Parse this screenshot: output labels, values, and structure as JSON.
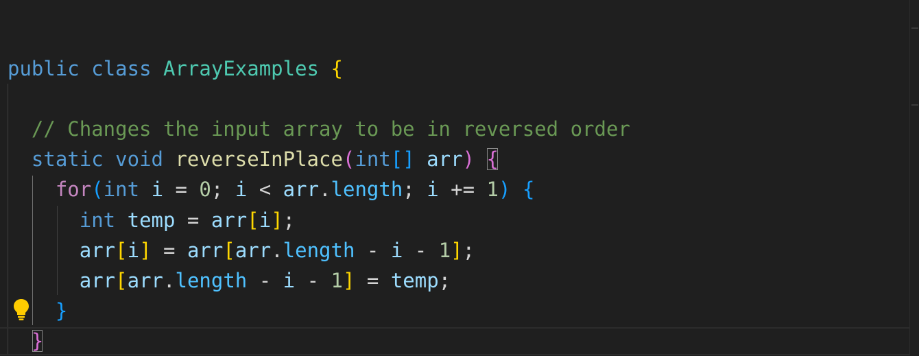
{
  "code_lines": [
    {
      "tokens": [
        {
          "t": "public",
          "c": "kw"
        },
        {
          "t": " ",
          "c": "op"
        },
        {
          "t": "class",
          "c": "kw"
        },
        {
          "t": " ",
          "c": "op"
        },
        {
          "t": "ArrayExamples",
          "c": "type"
        },
        {
          "t": " ",
          "c": "op"
        },
        {
          "t": "{",
          "c": "b1"
        }
      ]
    },
    {
      "tokens": [
        {
          "t": "  ",
          "c": "op"
        },
        {
          "t": "// Changes the input array to be in reversed order",
          "c": "cmt"
        }
      ]
    },
    {
      "tokens": [
        {
          "t": "  ",
          "c": "op"
        },
        {
          "t": "static",
          "c": "kw"
        },
        {
          "t": " ",
          "c": "op"
        },
        {
          "t": "void",
          "c": "kw"
        },
        {
          "t": " ",
          "c": "op"
        },
        {
          "t": "reverseInPlace",
          "c": "fn"
        },
        {
          "t": "(",
          "c": "b2"
        },
        {
          "t": "int",
          "c": "kw"
        },
        {
          "t": "[]",
          "c": "b3"
        },
        {
          "t": " ",
          "c": "op"
        },
        {
          "t": "arr",
          "c": "var"
        },
        {
          "t": ")",
          "c": "b2"
        },
        {
          "t": " ",
          "c": "op"
        },
        {
          "t": "{",
          "c": "b2",
          "match": true
        }
      ]
    },
    {
      "tokens": [
        {
          "t": "    ",
          "c": "op"
        },
        {
          "t": "for",
          "c": "ctl"
        },
        {
          "t": "(",
          "c": "b3"
        },
        {
          "t": "int",
          "c": "kw"
        },
        {
          "t": " ",
          "c": "op"
        },
        {
          "t": "i",
          "c": "var"
        },
        {
          "t": " = ",
          "c": "op"
        },
        {
          "t": "0",
          "c": "num"
        },
        {
          "t": "; ",
          "c": "op"
        },
        {
          "t": "i",
          "c": "var"
        },
        {
          "t": " < ",
          "c": "op"
        },
        {
          "t": "arr",
          "c": "var"
        },
        {
          "t": ".",
          "c": "op"
        },
        {
          "t": "length",
          "c": "prop"
        },
        {
          "t": "; ",
          "c": "op"
        },
        {
          "t": "i",
          "c": "var"
        },
        {
          "t": " += ",
          "c": "op"
        },
        {
          "t": "1",
          "c": "num"
        },
        {
          "t": ")",
          "c": "b3"
        },
        {
          "t": " ",
          "c": "op"
        },
        {
          "t": "{",
          "c": "b3"
        }
      ]
    },
    {
      "tokens": [
        {
          "t": "      ",
          "c": "op"
        },
        {
          "t": "int",
          "c": "kw"
        },
        {
          "t": " ",
          "c": "op"
        },
        {
          "t": "temp",
          "c": "var"
        },
        {
          "t": " = ",
          "c": "op"
        },
        {
          "t": "arr",
          "c": "var"
        },
        {
          "t": "[",
          "c": "b1"
        },
        {
          "t": "i",
          "c": "var"
        },
        {
          "t": "]",
          "c": "b1"
        },
        {
          "t": ";",
          "c": "op"
        }
      ]
    },
    {
      "tokens": [
        {
          "t": "      ",
          "c": "op"
        },
        {
          "t": "arr",
          "c": "var"
        },
        {
          "t": "[",
          "c": "b1"
        },
        {
          "t": "i",
          "c": "var"
        },
        {
          "t": "]",
          "c": "b1"
        },
        {
          "t": " = ",
          "c": "op"
        },
        {
          "t": "arr",
          "c": "var"
        },
        {
          "t": "[",
          "c": "b1"
        },
        {
          "t": "arr",
          "c": "var"
        },
        {
          "t": ".",
          "c": "op"
        },
        {
          "t": "length",
          "c": "prop"
        },
        {
          "t": " - ",
          "c": "op"
        },
        {
          "t": "i",
          "c": "var"
        },
        {
          "t": " - ",
          "c": "op"
        },
        {
          "t": "1",
          "c": "num"
        },
        {
          "t": "]",
          "c": "b1"
        },
        {
          "t": ";",
          "c": "op"
        }
      ]
    },
    {
      "tokens": [
        {
          "t": "      ",
          "c": "op"
        },
        {
          "t": "arr",
          "c": "var"
        },
        {
          "t": "[",
          "c": "b1"
        },
        {
          "t": "arr",
          "c": "var"
        },
        {
          "t": ".",
          "c": "op"
        },
        {
          "t": "length",
          "c": "prop"
        },
        {
          "t": " - ",
          "c": "op"
        },
        {
          "t": "i",
          "c": "var"
        },
        {
          "t": " - ",
          "c": "op"
        },
        {
          "t": "1",
          "c": "num"
        },
        {
          "t": "]",
          "c": "b1"
        },
        {
          "t": " = ",
          "c": "op"
        },
        {
          "t": "temp",
          "c": "var"
        },
        {
          "t": ";",
          "c": "op"
        }
      ]
    },
    {
      "tokens": [
        {
          "t": "    ",
          "c": "op"
        },
        {
          "t": "}",
          "c": "b3"
        }
      ]
    },
    {
      "tokens": [
        {
          "t": "  ",
          "c": "op"
        },
        {
          "t": "}",
          "c": "b2",
          "match": true
        }
      ]
    }
  ],
  "lightbulb": {
    "icon": "lightbulb-icon",
    "color": "#ffcc00"
  },
  "colors": {
    "background": "#1f1f1f",
    "keyword": "#569cd6",
    "control": "#c586c0",
    "type": "#4ec9b0",
    "function": "#dcdcaa",
    "variable": "#9cdcfe",
    "property": "#4fc1ff",
    "number": "#b5cea8",
    "comment": "#6a9955",
    "bracket_level1": "#ffd700",
    "bracket_level2": "#da70d6",
    "bracket_level3": "#179fff"
  }
}
